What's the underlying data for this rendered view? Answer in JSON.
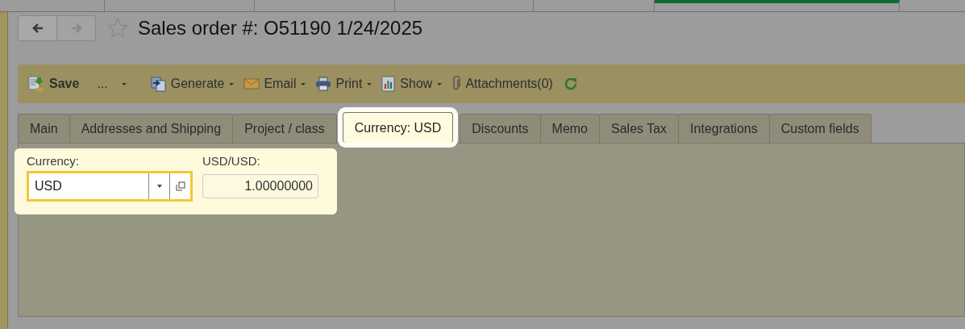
{
  "header": {
    "back": {
      "disabled": false
    },
    "forward": {
      "disabled": true
    },
    "favorite": {
      "on": false
    },
    "title": "Sales order #: O51190 1/24/2025"
  },
  "toolbar": [
    {
      "kind": "button",
      "label": "Save"
    },
    {
      "kind": "menu",
      "label": "..."
    },
    {
      "kind": "menu",
      "label": "Generate"
    },
    {
      "kind": "menu",
      "label": "Email"
    },
    {
      "kind": "menu",
      "label": "Print"
    },
    {
      "kind": "menu",
      "label": "Show"
    },
    {
      "kind": "button",
      "label": "Attachments(0)"
    },
    {
      "kind": "refresh"
    }
  ],
  "tabs": [
    {
      "label": "Main",
      "selected": false
    },
    {
      "label": "Addresses and Shipping",
      "selected": false
    },
    {
      "label": "Project / class",
      "selected": false
    },
    {
      "label": "Currency: USD",
      "selected": true
    },
    {
      "label": "Discounts",
      "selected": false
    },
    {
      "label": "Memo",
      "selected": false
    },
    {
      "label": "Sales Tax",
      "selected": false
    },
    {
      "label": "Integrations",
      "selected": false
    },
    {
      "label": "Custom fields",
      "selected": false
    }
  ],
  "currency_panel": {
    "currency": {
      "label": "Currency:",
      "value": "USD",
      "highlighted": true
    },
    "rate": {
      "label": "USD/USD:",
      "value": "1.00000000"
    }
  }
}
